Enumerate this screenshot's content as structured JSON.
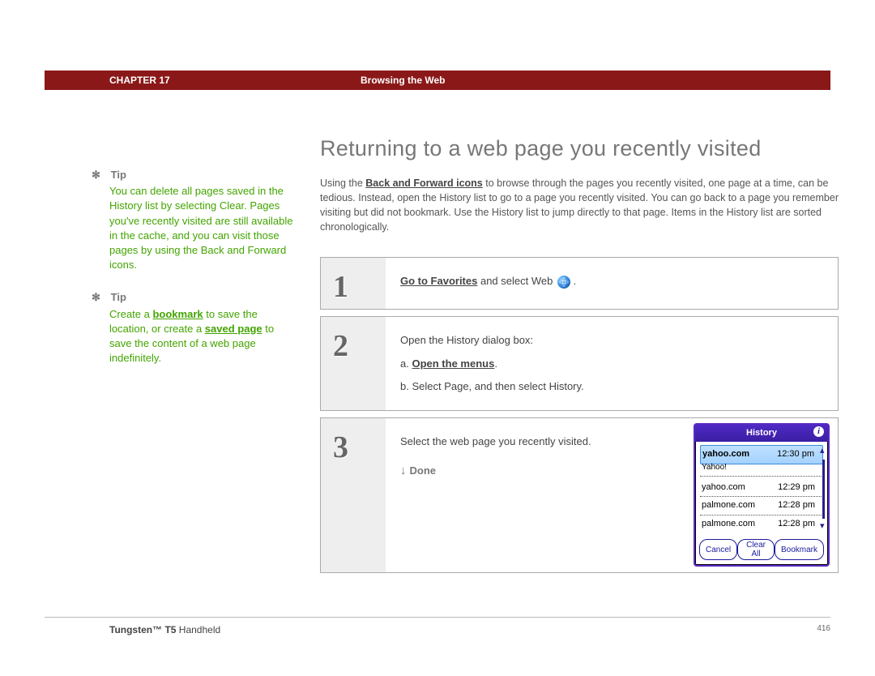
{
  "header": {
    "chapter_label": "CHAPTER 17",
    "chapter_title": "Browsing the Web"
  },
  "sidebar": {
    "tip_label": "Tip",
    "tip1": "You can delete all pages saved in the History list by selecting Clear. Pages you've recently visited are still available in the cache, and you can visit those pages by using the Back and Forward icons.",
    "tip2_pre": "Create a ",
    "tip2_link1": "bookmark",
    "tip2_mid": " to save the location, or create a ",
    "tip2_link2": "saved page",
    "tip2_post": " to save the content of a web page indefinitely."
  },
  "main": {
    "title": "Returning to a web page you recently visited",
    "intro_pre": "Using the ",
    "intro_link": "Back and Forward icons",
    "intro_post": " to browse through the pages you recently visited, one page at a time, can be tedious. Instead, open the History list to go to a page you recently visited. You can go back to a page you remember visiting but did not bookmark. Use the History list to jump directly to that page. Items in the History list are sorted chronologically."
  },
  "steps": {
    "s1_num": "1",
    "s1_link": "Go to Favorites",
    "s1_rest": " and select Web ",
    "s2_num": "2",
    "s2_line1": "Open the History dialog box:",
    "s2_a_label": "a.  ",
    "s2_a_link": "Open the menus",
    "s2_a_tail": ".",
    "s2_b": "b.  Select Page, and then select History.",
    "s3_num": "3",
    "s3_text": "Select the web page you recently visited.",
    "done": "Done"
  },
  "history": {
    "title": "History",
    "items": [
      {
        "url": "yahoo.com",
        "time": "12:30 pm",
        "sub": "Yahoo!"
      },
      {
        "url": "yahoo.com",
        "time": "12:29 pm"
      },
      {
        "url": "palmone.com",
        "time": "12:28 pm"
      },
      {
        "url": "palmone.com",
        "time": "12:28 pm"
      }
    ],
    "btn_cancel": "Cancel",
    "btn_clear": "Clear All",
    "btn_bookmark": "Bookmark"
  },
  "footer": {
    "product_bold": "Tungsten™ T5",
    "product_rest": " Handheld",
    "page": "416"
  }
}
